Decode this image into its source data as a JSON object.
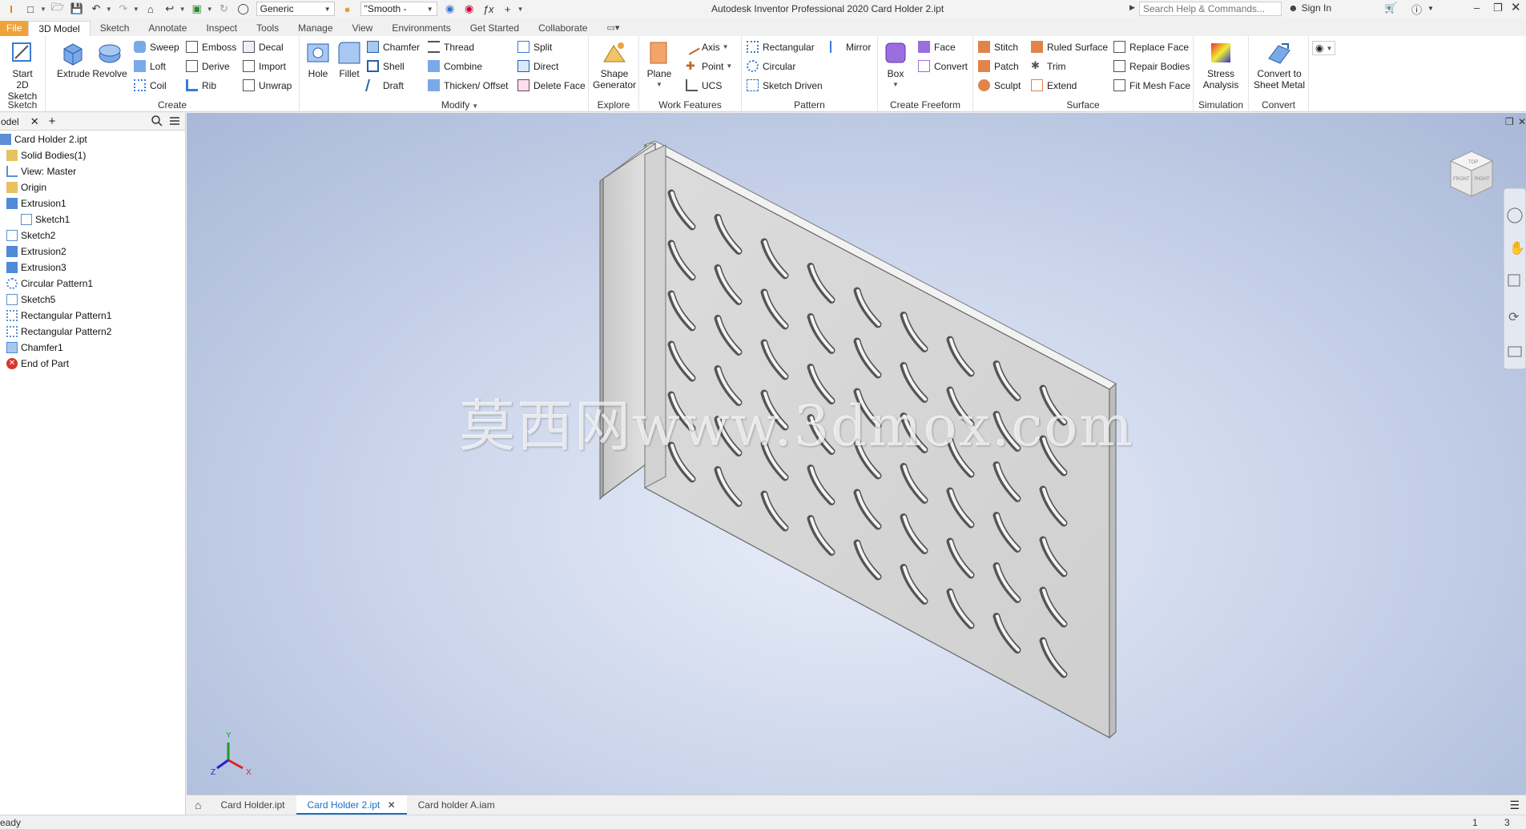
{
  "titlebar": {
    "app_title": "Autodesk Inventor Professional 2020   Card Holder 2.ipt",
    "material": "Generic",
    "appearance": "\"Smooth -",
    "search_placeholder": "Search Help & Commands...",
    "sign_in": "Sign In"
  },
  "tabs": [
    "File",
    "3D Model",
    "Sketch",
    "Annotate",
    "Inspect",
    "Tools",
    "Manage",
    "View",
    "Environments",
    "Get Started",
    "Collaborate"
  ],
  "active_tab": "3D Model",
  "ribbon": {
    "sketch": {
      "title": "Sketch",
      "start_sketch_1": "Start",
      "start_sketch_2": "2D Sketch"
    },
    "create": {
      "title": "Create",
      "extrude": "Extrude",
      "revolve": "Revolve",
      "sweep": "Sweep",
      "emboss": "Emboss",
      "decal": "Decal",
      "loft": "Loft",
      "derive": "Derive",
      "import": "Import",
      "coil": "Coil",
      "rib": "Rib",
      "unwrap": "Unwrap"
    },
    "modify": {
      "title": "Modify",
      "hole": "Hole",
      "fillet": "Fillet",
      "chamfer": "Chamfer",
      "thread": "Thread",
      "split": "Split",
      "shell": "Shell",
      "combine": "Combine",
      "direct": "Direct",
      "draft": "Draft",
      "thicken": "Thicken/ Offset",
      "delete_face": "Delete Face"
    },
    "explore": {
      "title": "Explore",
      "shape_gen_1": "Shape",
      "shape_gen_2": "Generator"
    },
    "work_features": {
      "title": "Work Features",
      "plane": "Plane",
      "axis": "Axis",
      "point": "Point",
      "ucs": "UCS"
    },
    "pattern": {
      "title": "Pattern",
      "rectangular": "Rectangular",
      "mirror": "Mirror",
      "circular": "Circular",
      "sketch_driven": "Sketch Driven"
    },
    "freeform": {
      "title": "Create Freeform",
      "box": "Box",
      "face": "Face",
      "convert": "Convert"
    },
    "surface": {
      "title": "Surface",
      "stitch": "Stitch",
      "ruled_surface": "Ruled Surface",
      "replace_face": "Replace Face",
      "patch": "Patch",
      "trim": "Trim",
      "repair_bodies": "Repair Bodies",
      "sculpt": "Sculpt",
      "extend": "Extend",
      "fit_mesh_face": "Fit Mesh Face"
    },
    "simulation": {
      "title": "Simulation",
      "stress_1": "Stress",
      "stress_2": "Analysis"
    },
    "convert": {
      "title": "Convert",
      "csm_1": "Convert to",
      "csm_2": "Sheet Metal"
    }
  },
  "browser": {
    "tab_label": "odel",
    "items": [
      {
        "label": "Card Holder 2.ipt",
        "indent": 0,
        "icon": "part-icon"
      },
      {
        "label": "Solid Bodies(1)",
        "indent": 1,
        "icon": "folder-icon"
      },
      {
        "label": "View: Master",
        "indent": 1,
        "icon": "view-icon"
      },
      {
        "label": "Origin",
        "indent": 1,
        "icon": "folder-icon"
      },
      {
        "label": "Extrusion1",
        "indent": 1,
        "icon": "extrusion-icon"
      },
      {
        "label": "Sketch1",
        "indent": 2,
        "icon": "sketch-icon"
      },
      {
        "label": "Sketch2",
        "indent": 1,
        "icon": "sketch-icon"
      },
      {
        "label": "Extrusion2",
        "indent": 1,
        "icon": "extrusion-icon"
      },
      {
        "label": "Extrusion3",
        "indent": 1,
        "icon": "extrusion-icon"
      },
      {
        "label": "Circular Pattern1",
        "indent": 1,
        "icon": "circular-pattern-icon"
      },
      {
        "label": "Sketch5",
        "indent": 1,
        "icon": "sketch-icon"
      },
      {
        "label": "Rectangular Pattern1",
        "indent": 1,
        "icon": "rect-pattern-icon"
      },
      {
        "label": "Rectangular Pattern2",
        "indent": 1,
        "icon": "rect-pattern-icon"
      },
      {
        "label": "Chamfer1",
        "indent": 1,
        "icon": "chamfer-icon"
      },
      {
        "label": "End of Part",
        "indent": 1,
        "icon": "end-of-part-icon"
      }
    ]
  },
  "viewport": {
    "watermark": "莫西网www.3dmox.com",
    "viewcube_front": "FRONT",
    "viewcube_right": "RIGHT",
    "viewcube_top": "TOP",
    "axis_x": "X",
    "axis_y": "Y",
    "axis_z": "Z"
  },
  "doctabs": [
    "Card Holder.ipt",
    "Card Holder 2.ipt",
    "Card holder A.iam"
  ],
  "active_doctab": "Card Holder 2.ipt",
  "status": {
    "text": "eady",
    "count1": "1",
    "count2": "3"
  },
  "colors": {
    "file_tab": "#f0a23a",
    "accent": "#1a6fc2",
    "viewport_top": "#a9b8d8",
    "viewport_center": "#e9eef8"
  }
}
